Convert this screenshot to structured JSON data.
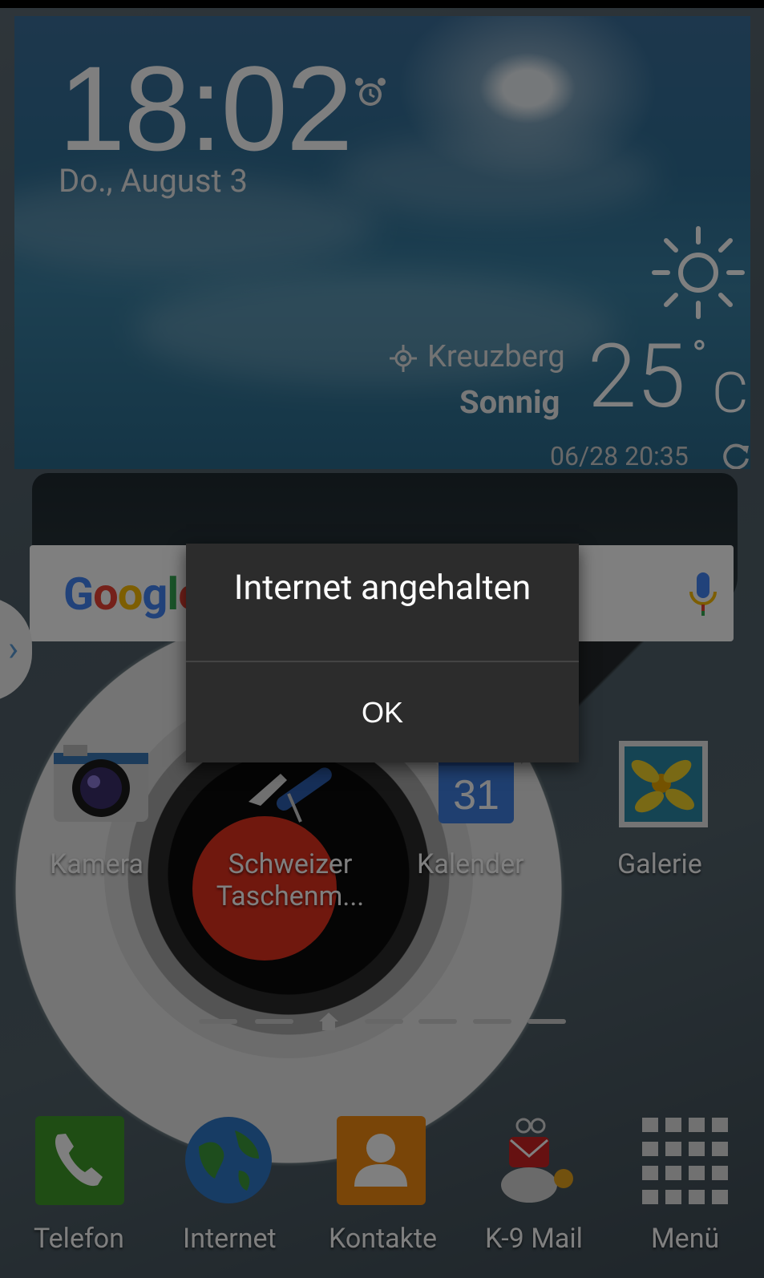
{
  "clock": {
    "time": "18:02",
    "date": "Do., August 3",
    "alarm_icon": "alarm-clock-icon"
  },
  "weather": {
    "location": "Kreuzberg",
    "condition": "Sonnig",
    "temperature": "25",
    "degree": "°",
    "unit": "C",
    "updated": "06/28 20:35",
    "icon": "sun-icon"
  },
  "search": {
    "logo": "Google",
    "mic_icon": "microphone-icon"
  },
  "apps": [
    {
      "label": "Kamera",
      "icon": "camera-icon"
    },
    {
      "label": "Schweizer Taschenm...",
      "line1": "Schweizer",
      "line2": "Taschenm...",
      "icon": "swiss-knife-icon"
    },
    {
      "label": "Kalender",
      "day": "31",
      "icon": "calendar-icon"
    },
    {
      "label": "Galerie",
      "icon": "gallery-icon"
    }
  ],
  "dock": [
    {
      "label": "Telefon",
      "icon": "phone-icon"
    },
    {
      "label": "Internet",
      "icon": "globe-icon"
    },
    {
      "label": "Kontakte",
      "icon": "contacts-icon"
    },
    {
      "label": "K-9 Mail",
      "icon": "k9-mail-icon"
    },
    {
      "label": "Menü",
      "icon": "app-grid-icon"
    }
  ],
  "dialog": {
    "title": "Internet angehalten",
    "ok": "OK"
  },
  "colors": {
    "dialog_bg": "#2c2c2c",
    "overlay": "rgba(0,0,0,0.5)",
    "accent_blue": "#4285f4"
  }
}
